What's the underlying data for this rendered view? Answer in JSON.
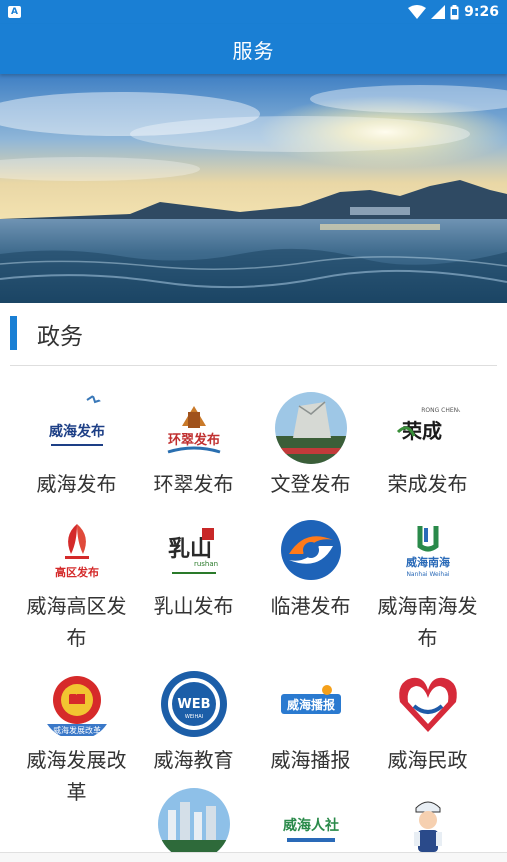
{
  "status": {
    "time": "9:26",
    "notification": "A"
  },
  "header": {
    "title": "服务"
  },
  "section": {
    "title": "政务"
  },
  "items": [
    {
      "label": "威海发布",
      "icon": "weihai-release-logo"
    },
    {
      "label": "环翠发布",
      "icon": "huancui-release-logo"
    },
    {
      "label": "文登发布",
      "icon": "wendeng-release-logo"
    },
    {
      "label": "荣成发布",
      "icon": "rongcheng-release-logo"
    },
    {
      "label": "威海高区发布",
      "icon": "weihai-hi-tech-zone-logo"
    },
    {
      "label": "乳山发布",
      "icon": "rushan-release-logo"
    },
    {
      "label": "临港发布",
      "icon": "lingang-release-logo"
    },
    {
      "label": "威海南海发布",
      "icon": "weihai-nanhai-logo"
    },
    {
      "label": "威海发展改革",
      "icon": "national-emblem-logo"
    },
    {
      "label": "威海教育",
      "icon": "weihai-education-logo"
    },
    {
      "label": "威海播报",
      "icon": "weihai-broadcast-logo"
    },
    {
      "label": "威海民政",
      "icon": "weihai-civil-affairs-logo"
    },
    {
      "label": "",
      "icon": "city-skyline-logo"
    },
    {
      "label": "",
      "icon": "weihai-hr-logo"
    },
    {
      "label": "",
      "icon": "traffic-police-logo"
    }
  ],
  "icon_texts": {
    "weihai_release": "威海发布",
    "huancui_release": "环翠发布",
    "rongcheng_en": "RONG CHENG",
    "rongcheng_cn": "荣成",
    "hi_tech": "高区发布",
    "rushan": "乳山",
    "rushan_en": "rushan",
    "nanhai_cn": "威海南海",
    "nanhai_en": "Nanhai Weihai",
    "emblem_ribbon": "威海发展改革",
    "web": "WEB",
    "weihai_en": "WEIHAI",
    "broadcast": "威海播报",
    "hr": "威海人社"
  },
  "colors": {
    "primary": "#1a7fd4",
    "text": "#333333",
    "divider": "#dedede"
  }
}
